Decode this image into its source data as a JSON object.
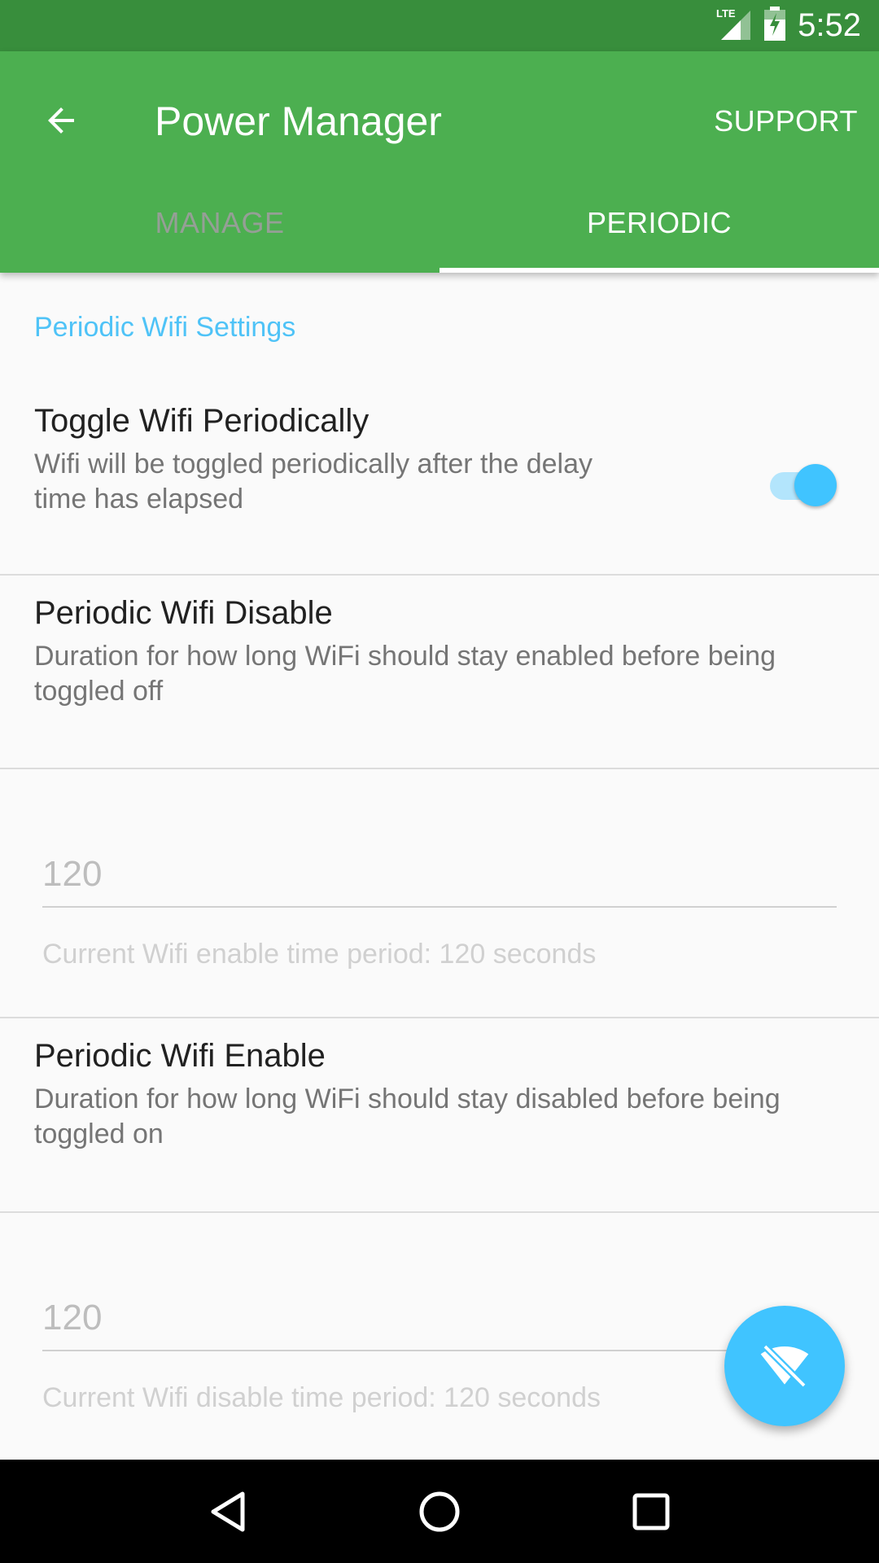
{
  "status_bar": {
    "network": "LTE",
    "time": "5:52"
  },
  "app_bar": {
    "title": "Power Manager",
    "support_label": "SUPPORT",
    "back_icon": "arrow-back-icon"
  },
  "tabs": [
    {
      "label": "MANAGE",
      "selected": false
    },
    {
      "label": "PERIODIC",
      "selected": true
    }
  ],
  "section": {
    "header": "Periodic Wifi Settings"
  },
  "toggle_pref": {
    "title": "Toggle Wifi Periodically",
    "summary_line1": "Wifi will be toggled periodically after the delay",
    "summary_line2": "time has elapsed",
    "checked": true
  },
  "disable_pref": {
    "title": "Periodic Wifi Disable",
    "summary_line1": "Duration for how long WiFi should stay enabled before being",
    "summary_line2": "toggled off",
    "value": "120",
    "helper": "Current Wifi enable time period: 120 seconds"
  },
  "enable_pref": {
    "title": "Periodic Wifi Enable",
    "summary_line1": "Duration for how long WiFi should stay disabled before being",
    "summary_line2": "toggled on",
    "value": "120",
    "helper": "Current Wifi disable time period: 120 seconds"
  },
  "fab": {
    "icon": "wifi-off-icon"
  },
  "colors": {
    "status_bar": "#388e3c",
    "primary": "#4caf50",
    "accent": "#40c4ff",
    "section_header": "#4fc3f7"
  }
}
